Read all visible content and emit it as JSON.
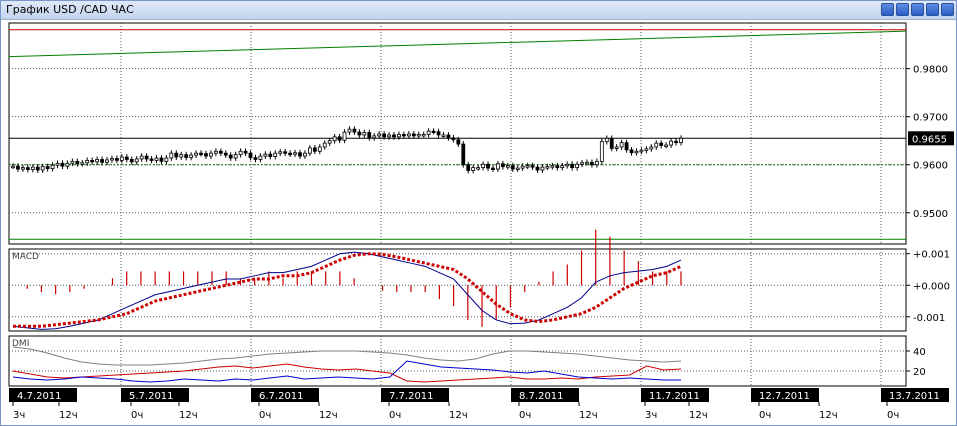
{
  "window": {
    "title": "График USD /CAD  ЧАС"
  },
  "title_buttons": [
    "help-icon",
    "panels-icon",
    "restore-icon",
    "minimize-icon",
    "close-icon"
  ],
  "colors": {
    "up": "#000000",
    "down": "#000000",
    "resistance": "#cc0000",
    "trend": "#008000",
    "support": "#008000",
    "macd_line": "#00008b",
    "macd_signal": "#cc0000",
    "macd_hist": "#cc0000",
    "dmi_adx": "#808080",
    "dmi_plus": "#cc0000",
    "dmi_minus": "#0000cc",
    "date_badge": "#000000",
    "price_badge": "#000000"
  },
  "chart_data": [
    {
      "type": "candlestick",
      "name": "price",
      "ylim": [
        0.9435,
        0.9895
      ],
      "yticks": [
        0.98,
        0.97,
        0.96,
        0.95
      ],
      "ytick_labels": [
        "0.9800",
        "0.9700",
        "0.9600",
        "0.9500"
      ],
      "last_price_label": "0.9655",
      "last_price": 0.9655,
      "resistance_level": 0.9881,
      "support_level": 0.9445,
      "dotted_level": 0.96,
      "trend_line": [
        0.9825,
        0.9878
      ],
      "close": [
        0.9597,
        0.9591,
        0.9594,
        0.959,
        0.9595,
        0.9589,
        0.9596,
        0.9592,
        0.9599,
        0.9603,
        0.9597,
        0.9603,
        0.9607,
        0.9602,
        0.9604,
        0.9609,
        0.9606,
        0.9611,
        0.9605,
        0.961,
        0.9613,
        0.9609,
        0.9616,
        0.9611,
        0.9606,
        0.9612,
        0.9618,
        0.9612,
        0.9609,
        0.9614,
        0.9607,
        0.9614,
        0.9624,
        0.9616,
        0.9621,
        0.9615,
        0.962,
        0.9624,
        0.9623,
        0.9618,
        0.9624,
        0.9628,
        0.9624,
        0.962,
        0.9614,
        0.9621,
        0.9628,
        0.9624,
        0.9615,
        0.9611,
        0.9618,
        0.9622,
        0.9617,
        0.9624,
        0.9627,
        0.9624,
        0.9622,
        0.9625,
        0.9618,
        0.9624,
        0.9635,
        0.9628,
        0.9637,
        0.9645,
        0.965,
        0.9658,
        0.9651,
        0.9668,
        0.9674,
        0.9668,
        0.9662,
        0.9667,
        0.9656,
        0.966,
        0.9664,
        0.9658,
        0.9662,
        0.9658,
        0.9663,
        0.966,
        0.9664,
        0.966,
        0.9663,
        0.9663,
        0.967,
        0.9669,
        0.9662,
        0.9662,
        0.9656,
        0.9652,
        0.9643,
        0.96,
        0.9588,
        0.9594,
        0.9594,
        0.9601,
        0.9593,
        0.9591,
        0.9602,
        0.9596,
        0.9598,
        0.9591,
        0.9593,
        0.9597,
        0.9598,
        0.9595,
        0.9589,
        0.9595,
        0.9596,
        0.9598,
        0.9594,
        0.9598,
        0.9601,
        0.9594,
        0.9601,
        0.9604,
        0.9605,
        0.96,
        0.9607,
        0.9648,
        0.9655,
        0.9634,
        0.9637,
        0.9646,
        0.9631,
        0.9625,
        0.9628,
        0.963,
        0.9633,
        0.9637,
        0.9645,
        0.964,
        0.9641,
        0.9649,
        0.9646,
        0.9655
      ]
    },
    {
      "type": "line",
      "name": "MACD",
      "label": "MACD",
      "ylim": [
        -0.00145,
        0.00115
      ],
      "yticks": [
        0.001,
        0.0,
        -0.001
      ],
      "ytick_labels": [
        "+0.001",
        "+0.000",
        "-0.001"
      ],
      "macd": [
        -0.0013,
        -0.00135,
        -0.0014,
        -0.00138,
        -0.0013,
        -0.0012,
        -0.0011,
        -0.0009,
        -0.0007,
        -0.0005,
        -0.0003,
        -0.0002,
        -0.0001,
        0.0,
        0.0001,
        0.0002,
        0.0002,
        0.0003,
        0.0004,
        0.0004,
        0.0005,
        0.0006,
        0.0008,
        0.001,
        0.00105,
        0.001,
        0.0009,
        0.0008,
        0.0007,
        0.0006,
        0.0004,
        0.0002,
        -0.0003,
        -0.0008,
        -0.0011,
        -0.00122,
        -0.0012,
        -0.0011,
        -0.0009,
        -0.0007,
        -0.0004,
        0.0001,
        0.0003,
        0.0004,
        0.00045,
        0.0005,
        0.0006,
        0.0008
      ],
      "signal": [
        -0.0013,
        -0.0013,
        -0.0013,
        -0.00125,
        -0.0012,
        -0.00115,
        -0.0011,
        -0.001,
        -0.0009,
        -0.0007,
        -0.0005,
        -0.0004,
        -0.0003,
        -0.0002,
        -0.0001,
        0.0,
        0.0001,
        0.0002,
        0.0002,
        0.0003,
        0.0003,
        0.0004,
        0.0006,
        0.0008,
        0.00095,
        0.001,
        0.00098,
        0.0009,
        0.0008,
        0.0007,
        0.0006,
        0.0005,
        0.0002,
        -0.0002,
        -0.0006,
        -0.0009,
        -0.0011,
        -0.00115,
        -0.0011,
        -0.001,
        -0.0009,
        -0.0007,
        -0.0004,
        -0.0001,
        0.0001,
        0.0003,
        0.0004,
        0.0006
      ]
    },
    {
      "type": "line",
      "name": "DMI",
      "label": "DMI",
      "ylim": [
        5,
        55
      ],
      "yticks": [
        40,
        20
      ],
      "ytick_labels": [
        "40",
        "20"
      ],
      "adx": [
        44,
        42,
        38,
        33,
        29,
        27,
        26,
        26,
        26,
        27,
        28,
        30,
        32,
        33,
        35,
        37,
        38,
        39,
        40,
        40,
        40,
        39,
        38,
        36,
        33,
        31,
        30,
        32,
        37,
        40,
        40,
        39,
        38,
        37,
        35,
        33,
        31,
        30,
        29,
        30
      ],
      "plus_di": [
        20,
        17,
        14,
        13,
        14,
        15,
        16,
        17,
        18,
        19,
        20,
        22,
        24,
        25,
        23,
        25,
        27,
        24,
        22,
        21,
        22,
        20,
        18,
        10,
        9,
        10,
        11,
        12,
        13,
        14,
        12,
        12,
        13,
        12,
        14,
        15,
        16,
        25,
        21,
        22
      ],
      "minus_di": [
        14,
        12,
        11,
        12,
        14,
        13,
        12,
        10,
        9,
        10,
        12,
        11,
        10,
        12,
        11,
        13,
        15,
        12,
        13,
        14,
        13,
        12,
        14,
        30,
        27,
        24,
        23,
        22,
        21,
        19,
        18,
        20,
        17,
        14,
        13,
        12,
        13,
        12,
        11,
        11
      ]
    }
  ],
  "x_axis": {
    "date_labels": [
      "4.7.2011",
      "5.7.2011",
      "6.7.2011",
      "7.7.2011",
      "8.7.2011",
      "11.7.2011",
      "12.7.2011",
      "13.7.2011"
    ],
    "hour_labels": [
      "3ч",
      "12ч",
      "0ч",
      "12ч",
      "0ч",
      "12ч",
      "0ч",
      "12ч",
      "0ч",
      "12ч",
      "3ч",
      "12ч",
      "0ч",
      "12ч",
      "0ч"
    ]
  }
}
